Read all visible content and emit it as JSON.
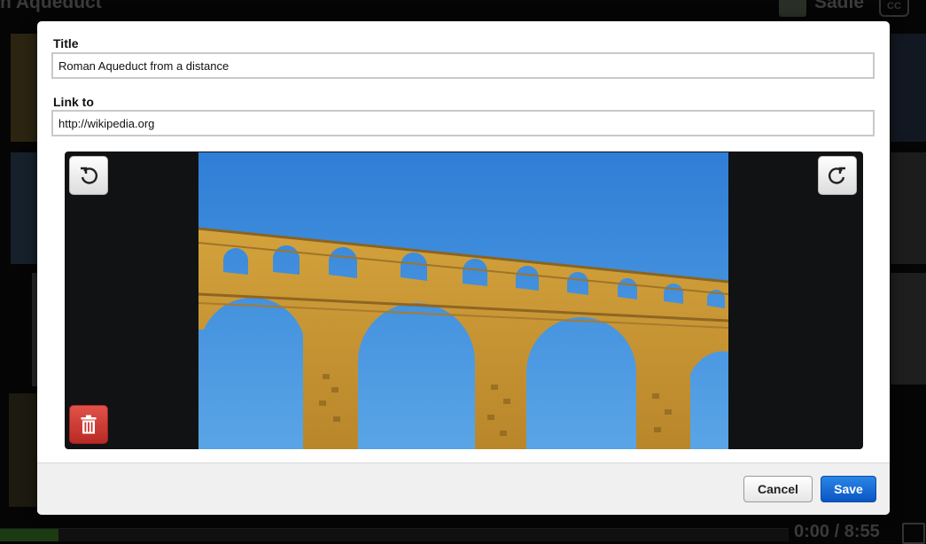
{
  "background": {
    "video_title": "n Aqueduct",
    "user_name": "Sadie",
    "cc_label": "CC",
    "time_display": "0:00 / 8:55",
    "progress_fraction": 0.074
  },
  "dialog": {
    "title_label": "Title",
    "title_value": "Roman Aqueduct from a distance",
    "link_label": "Link to",
    "link_value": "http://wikipedia.org",
    "icons": {
      "rotate_left": "rotate-left-icon",
      "rotate_right": "rotate-right-icon",
      "delete": "trash-icon"
    },
    "cancel_label": "Cancel",
    "save_label": "Save"
  },
  "colors": {
    "save_blue": "#0b62d6",
    "delete_red": "#c8362f",
    "sky_blue": "#3a86d6",
    "stone_ochre": "#c99a30"
  }
}
